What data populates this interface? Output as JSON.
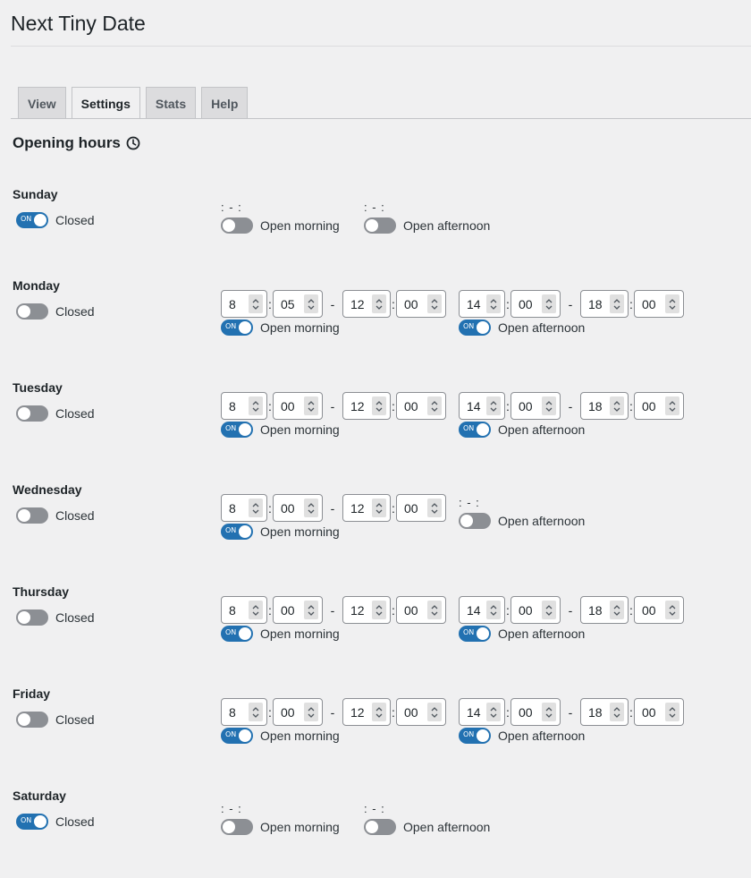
{
  "app": {
    "title": "Next Tiny Date"
  },
  "tabs": [
    {
      "label": "View",
      "active": false
    },
    {
      "label": "Settings",
      "active": true
    },
    {
      "label": "Stats",
      "active": false
    },
    {
      "label": "Help",
      "active": false
    }
  ],
  "section": {
    "title": "Opening hours",
    "icon": "clock-icon"
  },
  "labels": {
    "closed": "Closed",
    "open_morning": "Open morning",
    "open_afternoon": "Open afternoon",
    "on": "ON",
    "time_placeholder": ": - :",
    "colon": ":",
    "dash": "-"
  },
  "colors": {
    "accent": "#2271b1",
    "toggle_off": "#8c8f94",
    "background": "#f0f0f1"
  },
  "days": [
    {
      "name": "Sunday",
      "closed": true,
      "morning": {
        "open": false,
        "from_h": "",
        "from_m": "",
        "to_h": "",
        "to_m": ""
      },
      "afternoon": {
        "open": false,
        "from_h": "",
        "from_m": "",
        "to_h": "",
        "to_m": ""
      }
    },
    {
      "name": "Monday",
      "closed": false,
      "morning": {
        "open": true,
        "from_h": "8",
        "from_m": "05",
        "to_h": "12",
        "to_m": "00"
      },
      "afternoon": {
        "open": true,
        "from_h": "14",
        "from_m": "00",
        "to_h": "18",
        "to_m": "00"
      }
    },
    {
      "name": "Tuesday",
      "closed": false,
      "morning": {
        "open": true,
        "from_h": "8",
        "from_m": "00",
        "to_h": "12",
        "to_m": "00"
      },
      "afternoon": {
        "open": true,
        "from_h": "14",
        "from_m": "00",
        "to_h": "18",
        "to_m": "00"
      }
    },
    {
      "name": "Wednesday",
      "closed": false,
      "morning": {
        "open": true,
        "from_h": "8",
        "from_m": "00",
        "to_h": "12",
        "to_m": "00"
      },
      "afternoon": {
        "open": false,
        "from_h": "",
        "from_m": "",
        "to_h": "",
        "to_m": ""
      }
    },
    {
      "name": "Thursday",
      "closed": false,
      "morning": {
        "open": true,
        "from_h": "8",
        "from_m": "00",
        "to_h": "12",
        "to_m": "00"
      },
      "afternoon": {
        "open": true,
        "from_h": "14",
        "from_m": "00",
        "to_h": "18",
        "to_m": "00"
      }
    },
    {
      "name": "Friday",
      "closed": false,
      "morning": {
        "open": true,
        "from_h": "8",
        "from_m": "00",
        "to_h": "12",
        "to_m": "00"
      },
      "afternoon": {
        "open": true,
        "from_h": "14",
        "from_m": "00",
        "to_h": "18",
        "to_m": "00"
      }
    },
    {
      "name": "Saturday",
      "closed": true,
      "morning": {
        "open": false,
        "from_h": "",
        "from_m": "",
        "to_h": "",
        "to_m": ""
      },
      "afternoon": {
        "open": false,
        "from_h": "",
        "from_m": "",
        "to_h": "",
        "to_m": ""
      }
    }
  ]
}
